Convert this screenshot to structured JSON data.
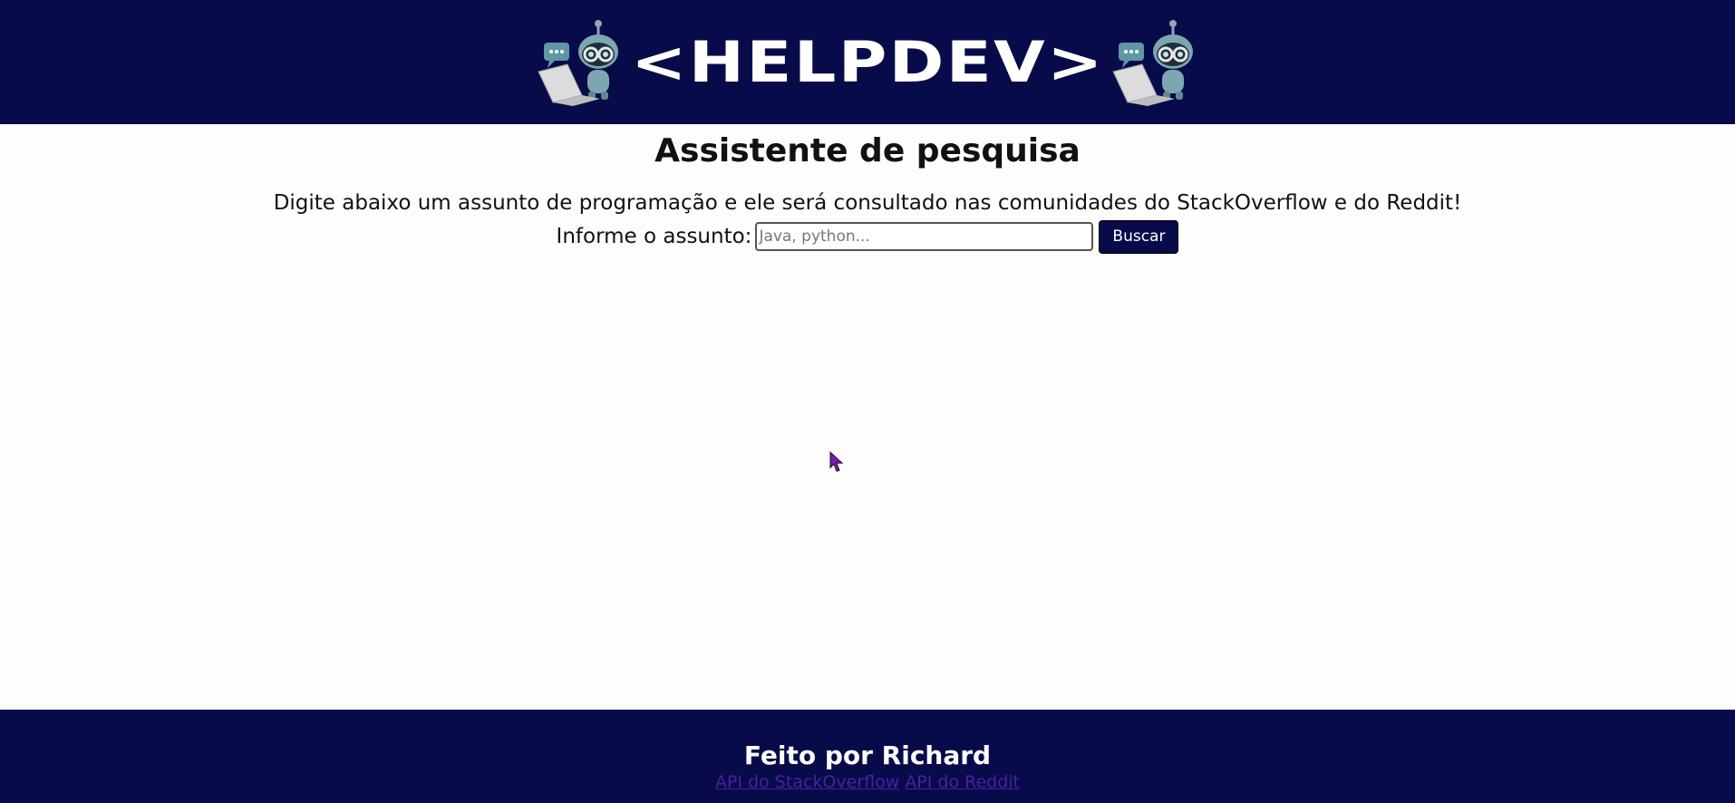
{
  "header": {
    "brand": "<HELPDEV>",
    "mascot_icon": "robot-laptop-icon",
    "background": "#070b4a"
  },
  "main": {
    "title": "Assistente de pesquisa",
    "intro": "Digite abaixo um assunto de programação e ele será consultado nas comunidades do StackOverflow e do Reddit!",
    "form": {
      "label": "Informe o assunto:",
      "input_value": "",
      "input_placeholder": "Java, python...",
      "button_label": "Buscar"
    }
  },
  "footer": {
    "credit": "Feito por Richard",
    "links": [
      {
        "label": "API do StackOverflow"
      },
      {
        "label": "API do Reddit"
      }
    ],
    "link_color": "#4b1fa0"
  },
  "cursor_icon": "mouse-pointer-icon"
}
